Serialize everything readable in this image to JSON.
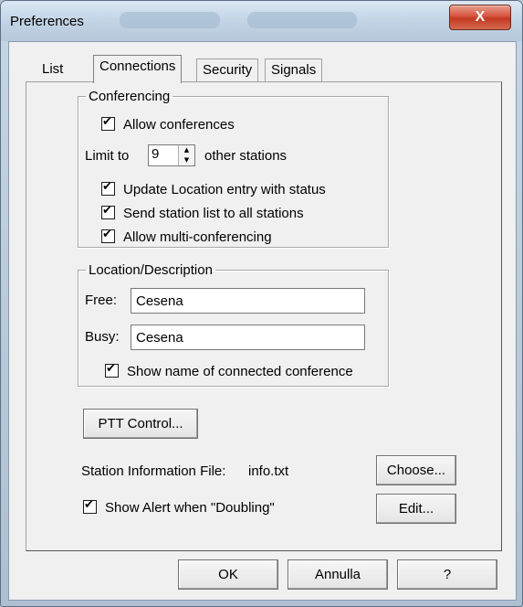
{
  "window": {
    "title": "Preferences",
    "close_glyph": "X"
  },
  "tabs": [
    {
      "label": "List",
      "active": false
    },
    {
      "label": "Connections",
      "active": true
    },
    {
      "label": "Security",
      "active": false
    },
    {
      "label": "Signals",
      "active": false
    }
  ],
  "conferencing": {
    "legend": "Conferencing",
    "allow_conferences": {
      "label": "Allow conferences",
      "checked": true
    },
    "limit_prefix": "Limit to",
    "limit_value": "9",
    "limit_suffix": "other stations",
    "update_location": {
      "label": "Update Location entry with status",
      "checked": true
    },
    "send_list": {
      "label": "Send station list to all stations",
      "checked": true
    },
    "multi_conf": {
      "label": "Allow multi-conferencing",
      "checked": true
    }
  },
  "location": {
    "legend": "Location/Description",
    "free_label": "Free:",
    "free_value": "Cesena",
    "busy_label": "Busy:",
    "busy_value": "Cesena",
    "show_name": {
      "label": "Show name of connected conference",
      "checked": true
    }
  },
  "ptt_button": "PTT Control...",
  "station_info": {
    "label": "Station Information File:",
    "value": "info.txt",
    "choose_button": "Choose..."
  },
  "show_alert": {
    "label": "Show Alert when \"Doubling\"",
    "checked": true
  },
  "edit_button": "Edit...",
  "footer": {
    "ok": "OK",
    "cancel": "Annulla",
    "help": "?"
  },
  "icons": {
    "spin_up": "▲",
    "spin_down": "▼"
  }
}
